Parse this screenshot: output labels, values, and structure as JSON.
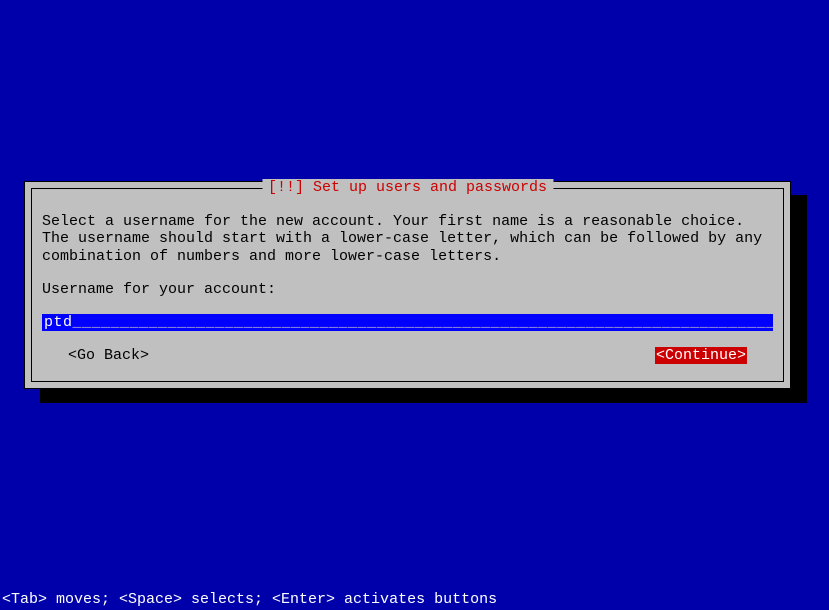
{
  "dialog": {
    "title": "[!!] Set up users and passwords",
    "instruction": "Select a username for the new account. Your first name is a reasonable choice. The username should start with a lower-case letter, which can be followed by any combination of numbers and more lower-case letters.",
    "field_label": "Username for your account:",
    "input_value": "ptd",
    "go_back_label": "<Go Back>",
    "continue_label": "<Continue>"
  },
  "status_bar": "<Tab> moves; <Space> selects; <Enter> activates buttons"
}
